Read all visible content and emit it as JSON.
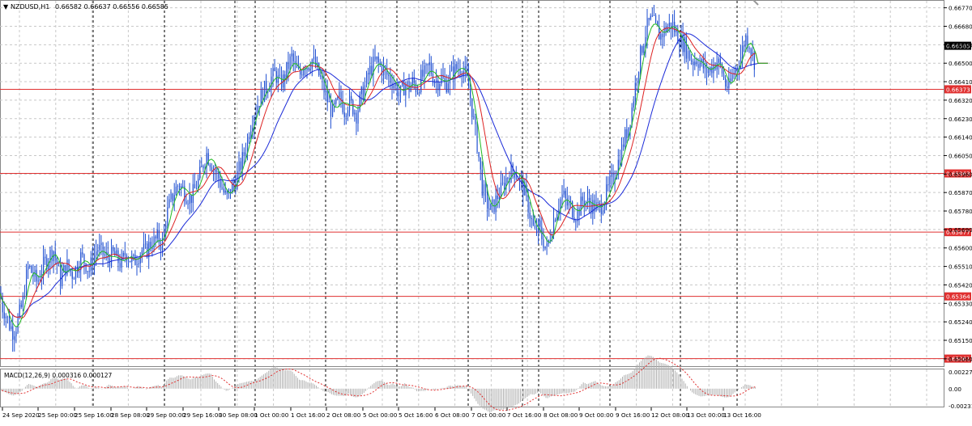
{
  "header": {
    "symbol_label": "NZDUSD,H1",
    "ohlc_label": "0.66582 0.66637 0.66556 0.66585"
  },
  "macd_label": "MACD(12,26,9) 0.000316 0.000127",
  "colors": {
    "candle": "#1f4fd1",
    "ma_fast": "#22bb22",
    "ma_mid": "#dd2222",
    "ma_slow": "#1a2ad8",
    "level_line": "#e03030",
    "grid": "#c8c8c8",
    "macd_signal": "#e03030",
    "macd_hist": "#b0b0b0"
  },
  "chart_data": [
    {
      "type": "line",
      "description_source": "price panel",
      "symbol": "NZDUSD",
      "timeframe": "H1",
      "ylim": [
        0.6501,
        0.6678
      ],
      "y_ticks": [
        "0.66770",
        "0.66680",
        "0.66590",
        "0.66500",
        "0.66410",
        "0.66320",
        "0.66230",
        "0.66140",
        "0.66050",
        "0.65960",
        "0.65870",
        "0.65780",
        "0.65690",
        "0.65600",
        "0.65510",
        "0.65420",
        "0.65330",
        "0.65240",
        "0.65150",
        "0.65060"
      ],
      "x_tick_labels": [
        "24 Sep 2020",
        "25 Sep 00:00",
        "25 Sep 16:00",
        "28 Sep 08:00",
        "29 Sep 00:00",
        "29 Sep 16:00",
        "30 Sep 08:00",
        "1 Oct 00:00",
        "1 Oct 16:00",
        "2 Oct 08:00",
        "5 Oct 00:00",
        "5 Oct 16:00",
        "6 Oct 08:00",
        "7 Oct 00:00",
        "7 Oct 16:00",
        "8 Oct 08:00",
        "9 Oct 00:00",
        "9 Oct 16:00",
        "12 Oct 08:00",
        "13 Oct 00:00",
        "13 Oct 16:00"
      ],
      "levels": [
        {
          "value": 0.66585,
          "label": "0.66585",
          "kind": "current"
        },
        {
          "value": 0.66373,
          "label": "0.66373",
          "kind": "line"
        },
        {
          "value": 0.65963,
          "label": "0.65963",
          "kind": "line"
        },
        {
          "value": 0.65677,
          "label": "0.65677",
          "kind": "line"
        },
        {
          "value": 0.65364,
          "label": "0.65364",
          "kind": "line"
        },
        {
          "value": 0.65061,
          "label": "0.65061",
          "kind": "line"
        }
      ],
      "close_path_x": [
        0,
        3,
        6,
        10,
        14,
        16,
        20,
        24,
        28,
        32,
        35,
        38,
        42,
        46,
        50,
        54,
        58,
        62,
        66,
        70,
        74,
        78,
        82,
        86,
        90,
        95,
        100,
        105,
        110,
        115,
        120,
        125,
        130,
        135,
        140,
        145,
        150,
        155,
        160,
        165,
        170,
        175,
        180,
        185,
        190,
        195,
        200,
        205,
        210,
        215,
        220,
        225,
        230,
        235,
        240,
        245,
        250,
        255,
        260,
        265,
        270,
        275,
        280,
        285,
        290,
        295,
        300,
        305,
        310,
        315,
        320,
        325,
        330,
        335,
        340,
        345,
        350,
        355,
        360,
        365,
        370,
        375,
        380,
        385,
        390,
        395,
        400,
        405,
        410,
        415,
        420,
        425,
        430,
        435,
        440,
        445,
        450,
        455,
        460,
        465,
        470,
        475,
        480,
        485,
        490,
        495,
        500,
        505,
        510,
        515,
        520,
        525,
        530,
        535,
        540,
        545,
        550,
        555,
        560,
        565,
        570,
        575,
        580,
        585,
        590,
        595,
        600,
        605,
        610,
        615,
        620,
        625,
        630,
        635,
        640,
        645,
        650,
        655,
        660,
        665,
        670,
        675,
        680,
        685,
        690,
        695,
        700,
        705,
        710,
        715,
        720,
        725,
        730,
        735,
        740,
        745,
        750,
        755,
        760,
        765,
        770,
        775,
        780,
        785,
        790,
        795,
        800,
        805,
        810,
        815,
        820,
        825,
        830,
        835,
        840,
        845,
        850,
        855,
        860,
        865,
        870,
        875,
        880,
        885,
        890,
        895,
        900,
        905,
        910,
        915,
        920,
        925,
        930,
        933
      ],
      "close_path_y": [
        0.6538,
        0.6531,
        0.6529,
        0.6524,
        0.6521,
        0.6519,
        0.6522,
        0.6528,
        0.6533,
        0.6545,
        0.6551,
        0.6549,
        0.6546,
        0.6543,
        0.6548,
        0.6552,
        0.6554,
        0.6557,
        0.6559,
        0.6553,
        0.6544,
        0.6548,
        0.6552,
        0.6549,
        0.6547,
        0.6551,
        0.6556,
        0.6553,
        0.6549,
        0.6555,
        0.656,
        0.6558,
        0.6556,
        0.6555,
        0.6557,
        0.6554,
        0.6552,
        0.6558,
        0.6555,
        0.6553,
        0.6556,
        0.6559,
        0.6558,
        0.6562,
        0.6563,
        0.6565,
        0.6561,
        0.6575,
        0.6582,
        0.6587,
        0.6591,
        0.6589,
        0.6586,
        0.6584,
        0.6588,
        0.6593,
        0.66,
        0.6606,
        0.6602,
        0.6598,
        0.6594,
        0.6588,
        0.6584,
        0.6589,
        0.6592,
        0.6598,
        0.6604,
        0.6612,
        0.6621,
        0.6627,
        0.6632,
        0.6636,
        0.6639,
        0.6643,
        0.6645,
        0.664,
        0.6642,
        0.6648,
        0.6653,
        0.6647,
        0.6644,
        0.665,
        0.6649,
        0.6652,
        0.6648,
        0.6643,
        0.6637,
        0.6631,
        0.6626,
        0.6629,
        0.6634,
        0.6627,
        0.6631,
        0.6629,
        0.6625,
        0.6633,
        0.6638,
        0.6645,
        0.6649,
        0.6651,
        0.6648,
        0.6646,
        0.6643,
        0.6641,
        0.6637,
        0.6635,
        0.664,
        0.6638,
        0.6641,
        0.6637,
        0.6643,
        0.6645,
        0.6649,
        0.6643,
        0.6641,
        0.6643,
        0.6639,
        0.6644,
        0.6646,
        0.6648,
        0.6648,
        0.6644,
        0.6635,
        0.6621,
        0.6608,
        0.659,
        0.6583,
        0.6578,
        0.6581,
        0.6586,
        0.6589,
        0.6594,
        0.6597,
        0.6598,
        0.6594,
        0.659,
        0.6584,
        0.6575,
        0.6567,
        0.657,
        0.6564,
        0.6559,
        0.6568,
        0.6576,
        0.6582,
        0.6586,
        0.6581,
        0.658,
        0.6576,
        0.6579,
        0.6584,
        0.6582,
        0.6581,
        0.658,
        0.6579,
        0.6583,
        0.6588,
        0.6593,
        0.6598,
        0.6604,
        0.6612,
        0.6618,
        0.6628,
        0.6641,
        0.6653,
        0.6662,
        0.6669,
        0.6671,
        0.6667,
        0.6663,
        0.6666,
        0.6668,
        0.6669,
        0.6664,
        0.6661,
        0.6659,
        0.6654,
        0.6651,
        0.6652,
        0.665,
        0.6647,
        0.6646,
        0.6649,
        0.6651,
        0.6648,
        0.664,
        0.6638,
        0.6645,
        0.6649,
        0.6654,
        0.6663,
        0.666,
        0.6652,
        0.665,
        0.6648,
        0.6645,
        0.6647,
        0.665,
        0.6653,
        0.6656,
        0.6659,
        0.666,
        0.66585
      ],
      "moving_averages_note": "three smoothed lines (green fast, red medium, blue slow) following the price"
    },
    {
      "type": "area",
      "name": "MACD(12,26,9)",
      "values_label": "0.000316 0.000127",
      "y_ticks": [
        "0.002272",
        "0.00",
        "-0.002314"
      ],
      "ylim": [
        -0.002314,
        0.002272
      ]
    }
  ]
}
